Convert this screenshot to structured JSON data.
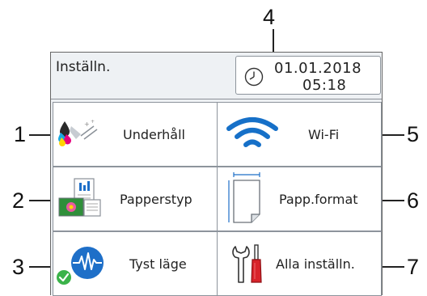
{
  "callouts": {
    "n1": "1",
    "n2": "2",
    "n3": "3",
    "n4": "4",
    "n5": "5",
    "n6": "6",
    "n7": "7"
  },
  "header": {
    "title": "Inställn.",
    "date": "01.01.2018",
    "time": "05:18"
  },
  "tiles": {
    "maintenance": {
      "label": "Underhåll",
      "icon": "ink-cartridge-icon"
    },
    "wifi": {
      "label": "Wi-Fi",
      "icon": "wifi-icon"
    },
    "paper_type": {
      "label": "Papperstyp",
      "icon": "paper-type-icon"
    },
    "paper_size": {
      "label": "Papp.format",
      "icon": "paper-size-icon"
    },
    "quiet_mode": {
      "label": "Tyst läge",
      "icon": "quiet-mode-icon"
    },
    "all_settings": {
      "label": "Alla inställn.",
      "icon": "wrench-screwdriver-icon"
    }
  },
  "colors": {
    "wifi_blue": "#1670c8",
    "quiet_blue": "#1e6fc8",
    "check_green": "#3bb34a",
    "screwdriver_red": "#d8232a"
  }
}
